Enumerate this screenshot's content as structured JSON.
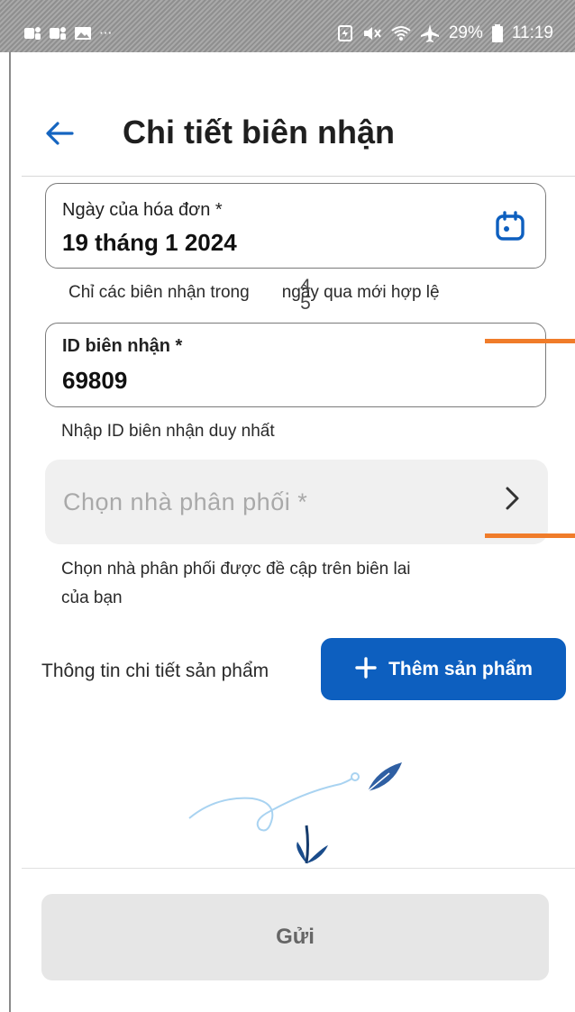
{
  "status_bar": {
    "left_icons": [
      "teams-icon",
      "teams-icon",
      "image-icon",
      "more-dots-icon"
    ],
    "more_dots": "···",
    "battery_percent": "29%",
    "time": "11:19"
  },
  "header": {
    "title": "Chi tiết biên nhận"
  },
  "form": {
    "date_field": {
      "label": "Ngày của hóa đơn *",
      "value": "19 tháng 1 2024"
    },
    "date_hint_before": "Chỉ các biên nhận trong",
    "date_hint_num_top": "4",
    "date_hint_num_bottom": "5",
    "date_hint_after": "ngày qua mới hợp lệ",
    "id_field": {
      "label": "ID biên nhận *",
      "value": "69809"
    },
    "id_hint": "Nhập ID biên nhận duy nhất",
    "distributor": {
      "placeholder": "Chọn nhà phân phối *",
      "hint": "Chọn nhà phân phối được đề cập trên biên lai của bạn"
    }
  },
  "products": {
    "section_label": "Thông tin chi tiết sản phẩm",
    "add_button_label": "Thêm sản phẩm"
  },
  "submit": {
    "label": "Gửi"
  },
  "colors": {
    "primary": "#0d5fbf",
    "accent_orange": "#f07c2a",
    "disabled_bg": "#e6e6e6",
    "select_bg": "#f0f0f0"
  }
}
